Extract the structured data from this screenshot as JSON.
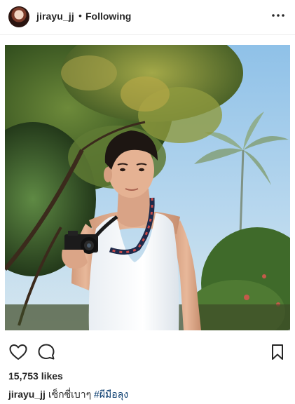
{
  "header": {
    "username": "jirayu_jj",
    "separator": "•",
    "follow_status": "Following",
    "more_icon": "more-horizontal-icon"
  },
  "post": {
    "image_description": "photo",
    "actions": {
      "like_icon": "heart-outline-icon",
      "comment_icon": "comment-bubble-icon",
      "save_icon": "bookmark-outline-icon"
    },
    "likes_text": "15,753 likes",
    "caption": {
      "username": "jirayu_jj",
      "text": "เซ็กซี่เบาๆ",
      "hashtag": "#ผีมือลุง"
    }
  },
  "colors": {
    "text": "#262626",
    "hashtag": "#003569",
    "divider": "#efefef"
  }
}
